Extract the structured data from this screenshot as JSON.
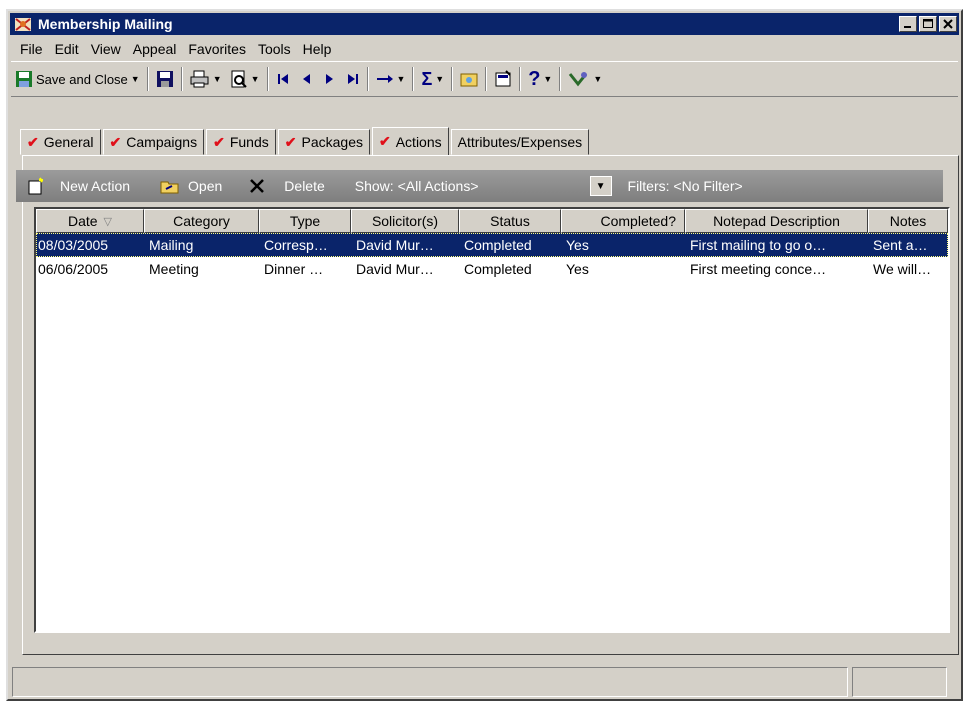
{
  "window": {
    "title": "Membership Mailing"
  },
  "menu": [
    "File",
    "Edit",
    "View",
    "Appeal",
    "Favorites",
    "Tools",
    "Help"
  ],
  "toolbar": {
    "save_close": "Save and Close"
  },
  "tabs": [
    {
      "label": "General",
      "checked": true
    },
    {
      "label": "Campaigns",
      "checked": true
    },
    {
      "label": "Funds",
      "checked": true
    },
    {
      "label": "Packages",
      "checked": true
    },
    {
      "label": "Actions",
      "checked": true,
      "active": true
    },
    {
      "label": "Attributes/Expenses",
      "checked": false
    }
  ],
  "actions_bar": {
    "new_action": "New Action",
    "open": "Open",
    "delete": "Delete",
    "show": "Show: <All Actions>",
    "filters": "Filters: <No Filter>"
  },
  "grid": {
    "columns": [
      "Date",
      "Category",
      "Type",
      "Solicitor(s)",
      "Status",
      "Completed?",
      "Notepad Description",
      "Notes"
    ],
    "rows": [
      [
        "08/03/2005",
        "Mailing",
        "Corresp…",
        "David Mur…",
        "Completed",
        "Yes",
        "First mailing to go o…",
        "Sent a…"
      ],
      [
        "06/06/2005",
        "Meeting",
        "Dinner …",
        "David Mur…",
        "Completed",
        "Yes",
        "First meeting conce…",
        "We will…"
      ]
    ]
  }
}
